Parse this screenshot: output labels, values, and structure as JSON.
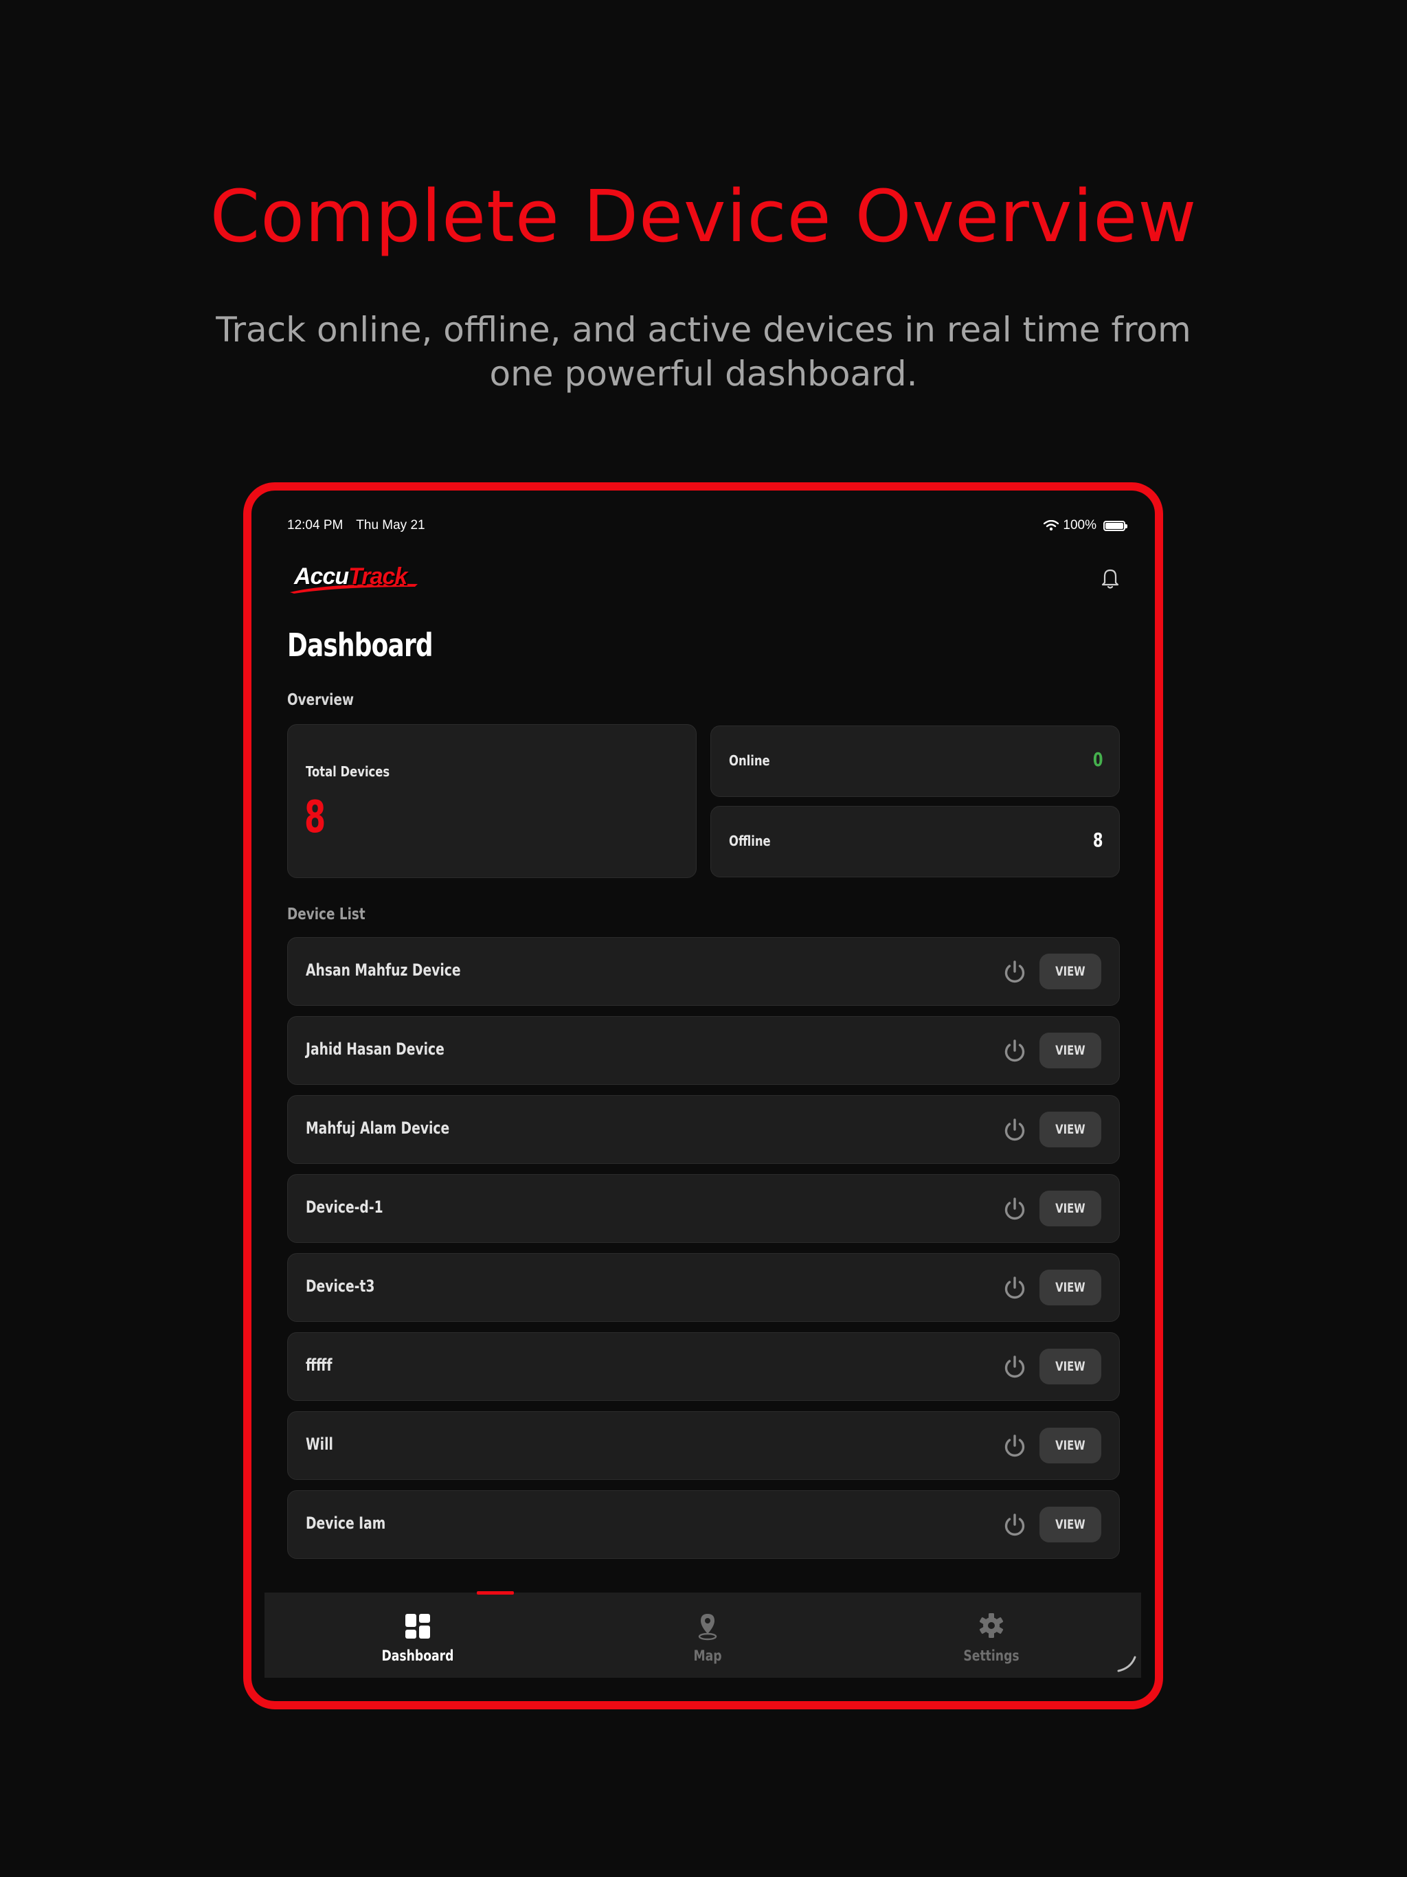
{
  "hero": {
    "headline": "Complete Device Overview",
    "subtitle": "Track online, offline, and active devices in real time from one powerful dashboard."
  },
  "status_bar": {
    "time": "12:04 PM",
    "date": "Thu May 21",
    "battery": "100%"
  },
  "app": {
    "logo": {
      "part1": "Accu",
      "part2": "Track"
    },
    "page_title": "Dashboard",
    "overview_label": "Overview",
    "total": {
      "label": "Total Devices",
      "value": "8"
    },
    "online": {
      "label": "Online",
      "value": "0"
    },
    "offline": {
      "label": "Offline",
      "value": "8"
    },
    "device_list_label": "Device List",
    "view_label": "VIEW",
    "devices": [
      {
        "name": "Ahsan Mahfuz Device"
      },
      {
        "name": "Jahid Hasan Device"
      },
      {
        "name": "Mahfuj Alam Device"
      },
      {
        "name": "Device-d-1"
      },
      {
        "name": "Device-t3"
      },
      {
        "name": "fffff"
      },
      {
        "name": "Will"
      },
      {
        "name": "Device Iam"
      }
    ]
  },
  "tabs": {
    "dashboard": "Dashboard",
    "map": "Map",
    "settings": "Settings"
  },
  "colors": {
    "accent": "#ee0a14",
    "online": "#45b04d",
    "background": "#0c0c0c",
    "card": "#1e1e1e"
  }
}
